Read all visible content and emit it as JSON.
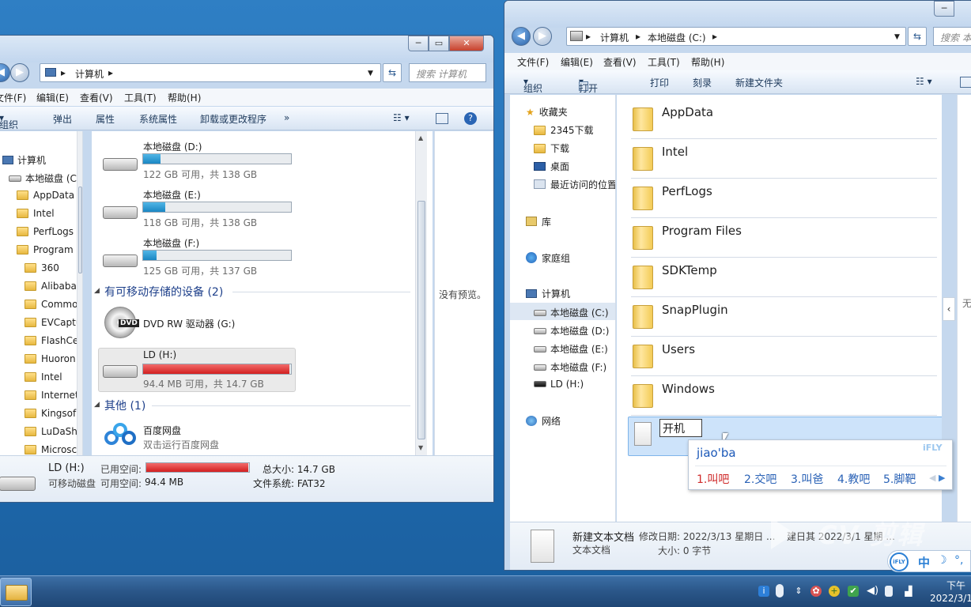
{
  "left_window": {
    "address_crumb": "计算机",
    "search_placeholder": "搜索 计算机",
    "menu": [
      "文件(F)",
      "编辑(E)",
      "查看(V)",
      "工具(T)",
      "帮助(H)"
    ],
    "toolbar": [
      "组织",
      "弹出",
      "属性",
      "系统属性",
      "卸载或更改程序",
      "»"
    ],
    "nav_tree": [
      {
        "label": "计算机",
        "type": "computer"
      },
      {
        "label": "本地磁盘 (C",
        "type": "drive"
      },
      {
        "label": "AppData",
        "type": "folder"
      },
      {
        "label": "Intel",
        "type": "folder"
      },
      {
        "label": "PerfLogs",
        "type": "folder"
      },
      {
        "label": "Program",
        "type": "folder"
      },
      {
        "label": "360",
        "type": "folder"
      },
      {
        "label": "Alibaba",
        "type": "folder"
      },
      {
        "label": "Commo",
        "type": "folder"
      },
      {
        "label": "EVCaptu",
        "type": "folder"
      },
      {
        "label": "FlashCe",
        "type": "folder"
      },
      {
        "label": "Huoron",
        "type": "folder"
      },
      {
        "label": "Intel",
        "type": "folder"
      },
      {
        "label": "Internet",
        "type": "folder"
      },
      {
        "label": "Kingsof",
        "type": "folder"
      },
      {
        "label": "LuDaShi",
        "type": "folder"
      },
      {
        "label": "Microsc",
        "type": "folder"
      }
    ],
    "drives": [
      {
        "name": "本地磁盘 (D:)",
        "free": "122 GB 可用，共 138 GB",
        "used_fraction": 0.12,
        "full": false
      },
      {
        "name": "本地磁盘 (E:)",
        "free": "118 GB 可用，共 138 GB",
        "used_fraction": 0.15,
        "full": false
      },
      {
        "name": "本地磁盘 (F:)",
        "free": "125 GB 可用，共 137 GB",
        "used_fraction": 0.09,
        "full": false
      }
    ],
    "removable_header": "有可移动存储的设备 (2)",
    "dvd_label": "DVD RW 驱动器 (G:)",
    "usb": {
      "name": "LD (H:)",
      "free": "94.4 MB 可用，共 14.7 GB",
      "used_fraction": 0.99,
      "full": true
    },
    "other_header": "其他 (1)",
    "baidu": {
      "name": "百度网盘",
      "sub": "双击运行百度网盘"
    },
    "preview_text": "没有预览。",
    "details": {
      "name": "LD (H:)",
      "type": "可移动磁盘",
      "used_label": "已用空间:",
      "free_label": "可用空间:",
      "free_value": "94.4 MB",
      "total_label": "总大小: 14.7 GB",
      "fs_label": "文件系统: FAT32",
      "used_fraction": 0.99
    }
  },
  "right_window": {
    "address_crumbs": [
      "计算机",
      "本地磁盘 (C:)"
    ],
    "search_placeholder": "搜索 本",
    "menu": [
      "文件(F)",
      "编辑(E)",
      "查看(V)",
      "工具(T)",
      "帮助(H)"
    ],
    "toolbar": [
      "组织",
      "打开",
      "打印",
      "刻录",
      "新建文件夹"
    ],
    "nav": {
      "favorites": "收藏夹",
      "fav_items": [
        "2345下载",
        "下载",
        "桌面",
        "最近访问的位置"
      ],
      "library": "库",
      "homegroup": "家庭组",
      "computer": "计算机",
      "drives": [
        "本地磁盘 (C:)",
        "本地磁盘 (D:)",
        "本地磁盘 (E:)",
        "本地磁盘 (F:)",
        "LD (H:)"
      ],
      "network": "网络"
    },
    "folders": [
      "AppData",
      "Intel",
      "PerfLogs",
      "Program Files",
      "SDKTemp",
      "SnapPlugin",
      "Users",
      "Windows"
    ],
    "rename_value": "开机",
    "preview_partial": "无",
    "details": {
      "name": "新建文本文档",
      "modified": "修改日期: 2022/3/13 星期日 ...",
      "type": "文本文档",
      "size": "大小: 0 字节",
      "right_fragment": "建日其 2022/3/1 星期 ..."
    }
  },
  "ime": {
    "pinyin": "jiao'ba",
    "candidates": [
      "1.叫吧",
      "2.交吧",
      "3.叫爸",
      "4.教吧",
      "5.脚靶"
    ],
    "brand": "iFLY",
    "status_mode": "中"
  },
  "watermark": "CV 剪辑",
  "taskbar": {
    "time": "下午",
    "date": "2022/3/1"
  }
}
